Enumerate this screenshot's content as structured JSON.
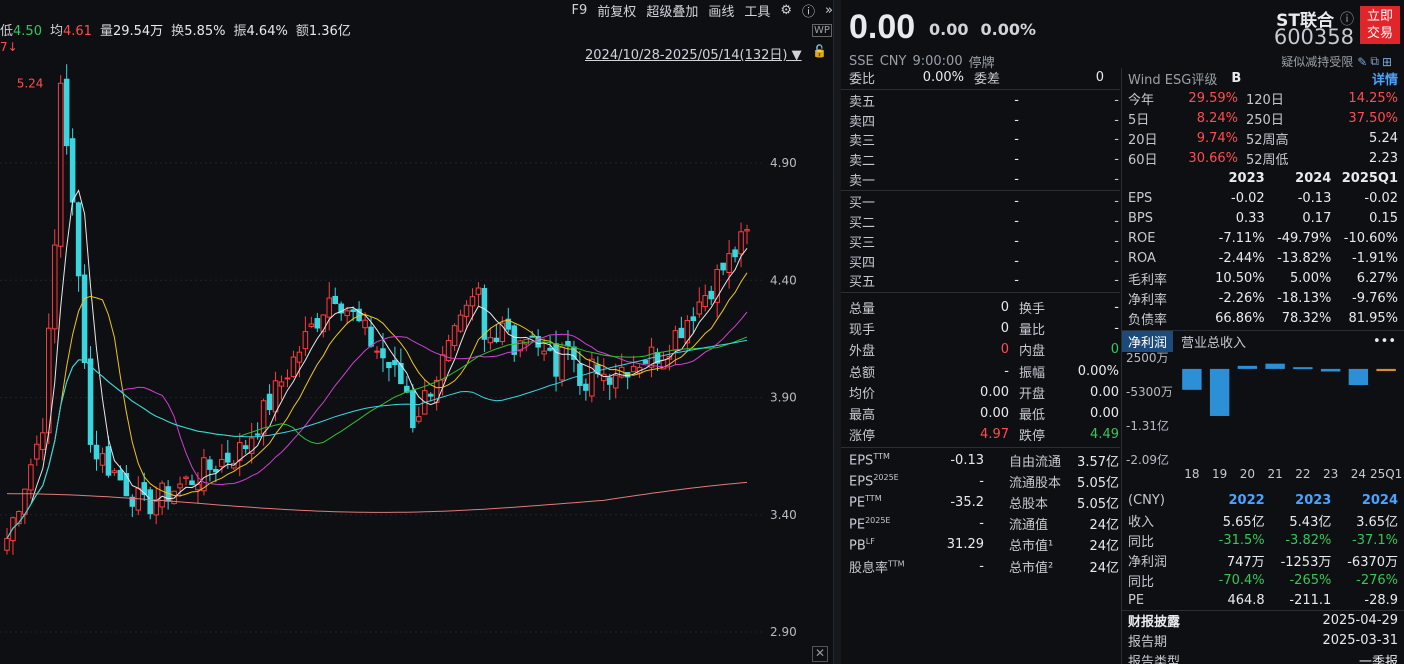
{
  "toolbar": {
    "stats": [
      {
        "k": "低",
        "v": "4.50",
        "color": "green"
      },
      {
        "k": "均",
        "v": "4.61",
        "color": "red"
      },
      {
        "k": "量",
        "v": "29.54万",
        "color": "white"
      },
      {
        "k": "换",
        "v": "5.85%",
        "color": "white"
      },
      {
        "k": "振",
        "v": "4.64%",
        "color": "white"
      },
      {
        "k": "额",
        "v": "1.36亿",
        "color": "white"
      }
    ],
    "stats_prefix_fragment": "7↓",
    "menu": [
      "F9",
      "前复权",
      "超级叠加",
      "画线",
      "工具"
    ],
    "range": "2024/10/28-2025/05/14(132日)"
  },
  "chart": {
    "y_ticks": [
      "4.90",
      "4.40",
      "3.90",
      "3.40",
      "2.90"
    ],
    "high_label": "5.24",
    "colors": {
      "up": "#ff3b3b",
      "down": "#3ad6e0",
      "ma5": "#e8e8e8",
      "ma10": "#f0c419",
      "ma20": "#d040d0",
      "ma60": "#30c030",
      "ma120": "#3ad6e0",
      "ma250": "#e07a7a"
    }
  },
  "quote": {
    "price": "0.00",
    "change": "0.00",
    "change_pct": "0.00%",
    "name": "ST联合",
    "code": "600358",
    "trade_button": [
      "立即",
      "交易"
    ],
    "sub": [
      "SSE",
      "CNY",
      "9:00:00",
      "停牌"
    ],
    "limit_tag": "疑似减持受限"
  },
  "book": {
    "header": {
      "k1": "委比",
      "v1": "0.00%",
      "k2": "委差",
      "v2": "0"
    },
    "sell": [
      {
        "k": "卖五",
        "p": "-",
        "q": "-"
      },
      {
        "k": "卖四",
        "p": "-",
        "q": "-"
      },
      {
        "k": "卖三",
        "p": "-",
        "q": "-"
      },
      {
        "k": "卖二",
        "p": "-",
        "q": "-"
      },
      {
        "k": "卖一",
        "p": "-",
        "q": "-"
      }
    ],
    "buy": [
      {
        "k": "买一",
        "p": "-",
        "q": "-"
      },
      {
        "k": "买二",
        "p": "-",
        "q": "-"
      },
      {
        "k": "买三",
        "p": "-",
        "q": "-"
      },
      {
        "k": "买四",
        "p": "-",
        "q": "-"
      },
      {
        "k": "买五",
        "p": "-",
        "q": "-"
      }
    ],
    "stats": [
      {
        "k1": "总量",
        "v1": "0",
        "k2": "换手",
        "v2": "-",
        "c1": "white",
        "c2": "white"
      },
      {
        "k1": "现手",
        "v1": "0",
        "k2": "量比",
        "v2": "-",
        "c1": "white",
        "c2": "white"
      },
      {
        "k1": "外盘",
        "v1": "0",
        "k2": "内盘",
        "v2": "0",
        "c1": "red",
        "c2": "green"
      },
      {
        "k1": "总额",
        "v1": "-",
        "k2": "振幅",
        "v2": "0.00%",
        "c1": "white",
        "c2": "white"
      },
      {
        "k1": "均价",
        "v1": "0.00",
        "k2": "开盘",
        "v2": "0.00",
        "c1": "white",
        "c2": "white"
      },
      {
        "k1": "最高",
        "v1": "0.00",
        "k2": "最低",
        "v2": "0.00",
        "c1": "white",
        "c2": "white"
      },
      {
        "k1": "涨停",
        "v1": "4.97",
        "k2": "跌停",
        "v2": "4.49",
        "c1": "red",
        "c2": "green"
      }
    ],
    "valuation": [
      {
        "k1": "EPS",
        "sup1": "TTM",
        "v1": "-0.13",
        "k2": "自由流通",
        "v2": "3.57亿"
      },
      {
        "k1": "EPS",
        "sup1": "2025E",
        "v1": "-",
        "k2": "流通股本",
        "v2": "5.05亿"
      },
      {
        "k1": "PE",
        "sup1": "TTM",
        "v1": "-35.2",
        "k2": "总股本",
        "v2": "5.05亿"
      },
      {
        "k1": "PE",
        "sup1": "2025E",
        "v1": "-",
        "k2": "流通值",
        "v2": "24亿"
      },
      {
        "k1": "PB",
        "sup1": "LF",
        "v1": "31.29",
        "k2": "总市值¹",
        "v2": "24亿"
      },
      {
        "k1": "股息率",
        "sup1": "TTM",
        "v1": "-",
        "k2": "总市值²",
        "v2": "24亿"
      }
    ]
  },
  "fin": {
    "esg_label": "Wind ESG评级",
    "esg_grade": "B",
    "detail": "详情",
    "returns": [
      {
        "k1": "今年",
        "v1": "29.59%",
        "k2": "120日",
        "v2": "14.25%",
        "c1": "red",
        "c2": "red"
      },
      {
        "k1": "5日",
        "v1": "8.24%",
        "k2": "250日",
        "v2": "37.50%",
        "c1": "red",
        "c2": "red"
      },
      {
        "k1": "20日",
        "v1": "9.74%",
        "k2": "52周高",
        "v2": "5.24",
        "c1": "red",
        "c2": "white"
      },
      {
        "k1": "60日",
        "v1": "30.66%",
        "k2": "52周低",
        "v2": "2.23",
        "c1": "red",
        "c2": "white"
      }
    ],
    "years": [
      "2023",
      "2024",
      "2025Q1"
    ],
    "metrics": [
      {
        "k": "EPS",
        "v": [
          "-0.02",
          "-0.13",
          "-0.02"
        ]
      },
      {
        "k": "BPS",
        "v": [
          "0.33",
          "0.17",
          "0.15"
        ]
      },
      {
        "k": "ROE",
        "v": [
          "-7.11%",
          "-49.79%",
          "-10.60%"
        ]
      },
      {
        "k": "ROA",
        "v": [
          "-2.44%",
          "-13.82%",
          "-1.91%"
        ]
      },
      {
        "k": "毛利率",
        "v": [
          "10.50%",
          "5.00%",
          "6.27%"
        ]
      },
      {
        "k": "净利率",
        "v": [
          "-2.26%",
          "-18.13%",
          "-9.76%"
        ]
      },
      {
        "k": "负债率",
        "v": [
          "66.86%",
          "78.32%",
          "81.95%"
        ]
      }
    ],
    "tabs": [
      "净利润",
      "营业总收入"
    ],
    "more": "•••",
    "bar_axis": [
      "2500万",
      "-5300万",
      "-1.31亿",
      "-2.09亿"
    ],
    "bar_x": [
      "18",
      "19",
      "20",
      "21",
      "22",
      "23",
      "24",
      "25Q1"
    ],
    "bar_values": [
      -4800,
      -10800,
      700,
      1200,
      400,
      -600,
      -3700,
      -500
    ],
    "bar_colors": {
      "normal": "#2d8fd5",
      "last": "#e08a2a"
    },
    "table_header": [
      "(CNY)",
      "2022",
      "2023",
      "2024"
    ],
    "table": [
      {
        "k": "收入",
        "v": [
          "5.65亿",
          "5.43亿",
          "3.65亿"
        ],
        "c": [
          "white",
          "white",
          "white"
        ]
      },
      {
        "k": "同比",
        "v": [
          "-31.5%",
          "-3.82%",
          "-37.1%"
        ],
        "c": [
          "green",
          "green",
          "green"
        ]
      },
      {
        "k": "净利润",
        "v": [
          "747万",
          "-1253万",
          "-6370万"
        ],
        "c": [
          "white",
          "white",
          "white"
        ]
      },
      {
        "k": "同比",
        "v": [
          "-70.4%",
          "-265%",
          "-276%"
        ],
        "c": [
          "green",
          "green",
          "green"
        ]
      },
      {
        "k": "PE",
        "v": [
          "464.8",
          "-211.1",
          "-28.9"
        ],
        "c": [
          "white",
          "white",
          "white"
        ]
      }
    ],
    "report_title": "财报披露",
    "report_date": "2025-04-29",
    "report_period_label": "报告期",
    "report_period_value": "2025-03-31",
    "report_type_label": "报告类型",
    "report_type_value": "一季报"
  }
}
